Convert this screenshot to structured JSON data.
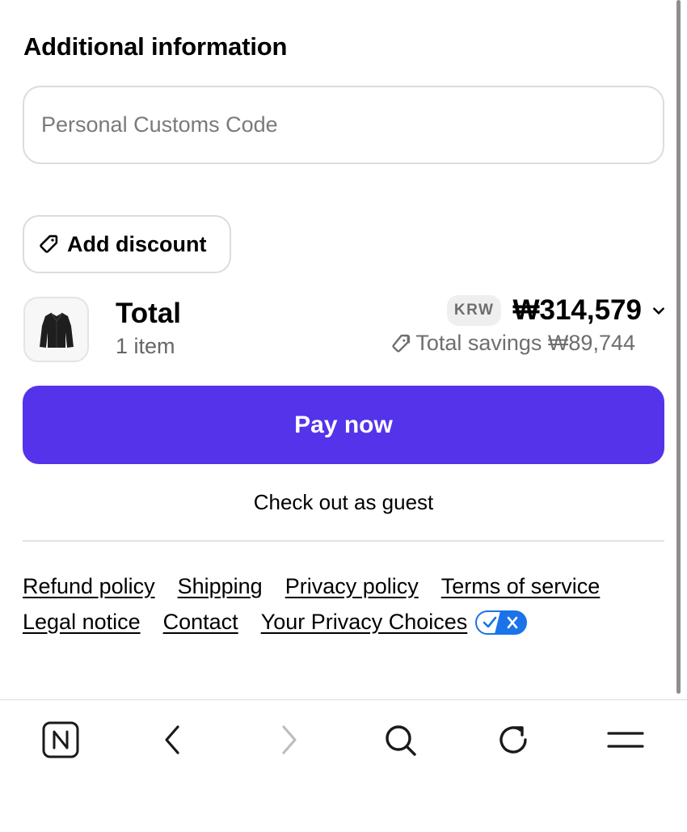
{
  "additional_info": {
    "title": "Additional information",
    "customs_placeholder": "Personal Customs Code",
    "customs_value": ""
  },
  "discount": {
    "label": "Add discount",
    "icon": "tag-icon"
  },
  "order_summary": {
    "total_label": "Total",
    "item_count": "1 item",
    "currency": "KRW",
    "total_price": "₩314,579",
    "savings_label": "Total savings ₩89,744",
    "product_image": "black-jacket-thumbnail"
  },
  "actions": {
    "pay_now": "Pay now",
    "guest_checkout": "Check out as guest"
  },
  "footer_links": {
    "row1": [
      "Refund policy",
      "Shipping",
      "Privacy policy",
      "Terms of service"
    ],
    "row2": [
      "Legal notice",
      "Contact",
      "Your Privacy Choices"
    ]
  },
  "colors": {
    "accent": "#5433eb",
    "privacy_toggle": "#1a73e8"
  },
  "browser_nav": {
    "icons": [
      "tab-n-icon",
      "back-icon",
      "forward-icon",
      "search-icon",
      "reload-icon",
      "menu-icon"
    ]
  }
}
